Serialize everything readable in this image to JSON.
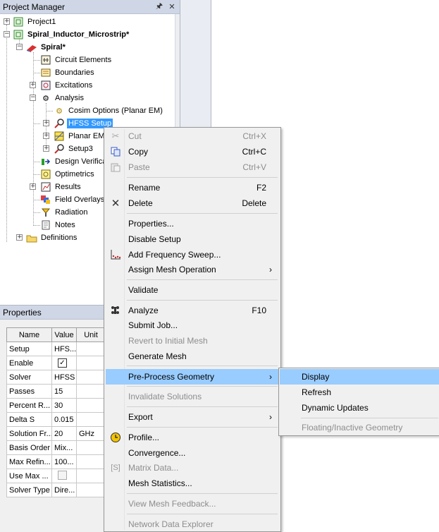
{
  "project_manager": {
    "title": "Project Manager",
    "pin_icon": "pin-icon",
    "close_icon": "close-icon",
    "tree": {
      "project1": "Project1",
      "spiral_project": "Spiral_Inductor_Microstrip*",
      "design": "Spiral*",
      "circuit_elements": "Circuit Elements",
      "boundaries": "Boundaries",
      "excitations": "Excitations",
      "analysis": "Analysis",
      "cosim_options": "Cosim Options (Planar EM)",
      "hfss_setup": "HFSS Setup",
      "planar_em": "Planar EM",
      "setup3": "Setup3",
      "design_verification": "Design Verifica",
      "optimetrics": "Optimetrics",
      "results": "Results",
      "field_overlays": "Field Overlays",
      "radiation": "Radiation",
      "notes": "Notes",
      "definitions": "Definitions"
    }
  },
  "properties": {
    "title": "Properties",
    "columns": [
      "Name",
      "Value",
      "Unit"
    ],
    "rows": [
      {
        "name": "Setup",
        "value": "HFS...",
        "unit": ""
      },
      {
        "name": "Enable",
        "value": "",
        "unit": "",
        "checkbox": "checked"
      },
      {
        "name": "Solver",
        "value": "HFSS",
        "unit": ""
      },
      {
        "name": "Passes",
        "value": "15",
        "unit": ""
      },
      {
        "name": "Percent R...",
        "value": "30",
        "unit": ""
      },
      {
        "name": "Delta S",
        "value": "0.015",
        "unit": ""
      },
      {
        "name": "Solution Fr...",
        "value": "20",
        "unit": "GHz"
      },
      {
        "name": "Basis Order",
        "value": "Mix...",
        "unit": ""
      },
      {
        "name": "Max Refin...",
        "value": "100...",
        "unit": ""
      },
      {
        "name": "Use Max ...",
        "value": "",
        "unit": "",
        "checkbox": "unchecked"
      },
      {
        "name": "Solver Type",
        "value": "Dire...",
        "unit": ""
      }
    ]
  },
  "context_menu": {
    "cut": {
      "label": "Cut",
      "shortcut": "Ctrl+X",
      "icon": "scissors-icon"
    },
    "copy": {
      "label": "Copy",
      "shortcut": "Ctrl+C",
      "icon": "copy-icon"
    },
    "paste": {
      "label": "Paste",
      "shortcut": "Ctrl+V",
      "icon": "paste-icon"
    },
    "rename": {
      "label": "Rename",
      "shortcut": "F2"
    },
    "delete": {
      "label": "Delete",
      "shortcut": "Delete",
      "icon": "x-icon"
    },
    "properties": {
      "label": "Properties..."
    },
    "disable_setup": {
      "label": "Disable Setup"
    },
    "add_frequency_sweep": {
      "label": "Add Frequency Sweep...",
      "icon": "sweep-icon"
    },
    "assign_mesh_operation": {
      "label": "Assign Mesh Operation"
    },
    "validate": {
      "label": "Validate"
    },
    "analyze": {
      "label": "Analyze",
      "shortcut": "F10",
      "icon": "analyze-icon"
    },
    "submit_job": {
      "label": "Submit Job..."
    },
    "revert_to_initial_mesh": {
      "label": "Revert to Initial Mesh"
    },
    "generate_mesh": {
      "label": "Generate Mesh"
    },
    "pre_process_geometry": {
      "label": "Pre-Process Geometry"
    },
    "invalidate_solutions": {
      "label": "Invalidate Solutions"
    },
    "export": {
      "label": "Export"
    },
    "profile": {
      "label": "Profile...",
      "icon": "clock-icon"
    },
    "convergence": {
      "label": "Convergence..."
    },
    "matrix_data": {
      "label": "Matrix Data...",
      "icon": "matrix-icon"
    },
    "mesh_statistics": {
      "label": "Mesh Statistics..."
    },
    "view_mesh_feedback": {
      "label": "View Mesh Feedback..."
    },
    "network_data_explorer": {
      "label": "Network Data Explorer"
    }
  },
  "submenu": {
    "display": "Display",
    "refresh": "Refresh",
    "dynamic_updates": "Dynamic Updates",
    "floating_inactive_geometry": "Floating/Inactive Geometry"
  },
  "matrix_icon_glyph": "[S]",
  "arrow_glyph": "›",
  "colors": {
    "highlight": "#99ccff",
    "selection": "#3399ff",
    "panel_title": "#cfd6e5",
    "menu_bg": "#f0f0f0",
    "disabled_text": "#8d8d8d"
  }
}
